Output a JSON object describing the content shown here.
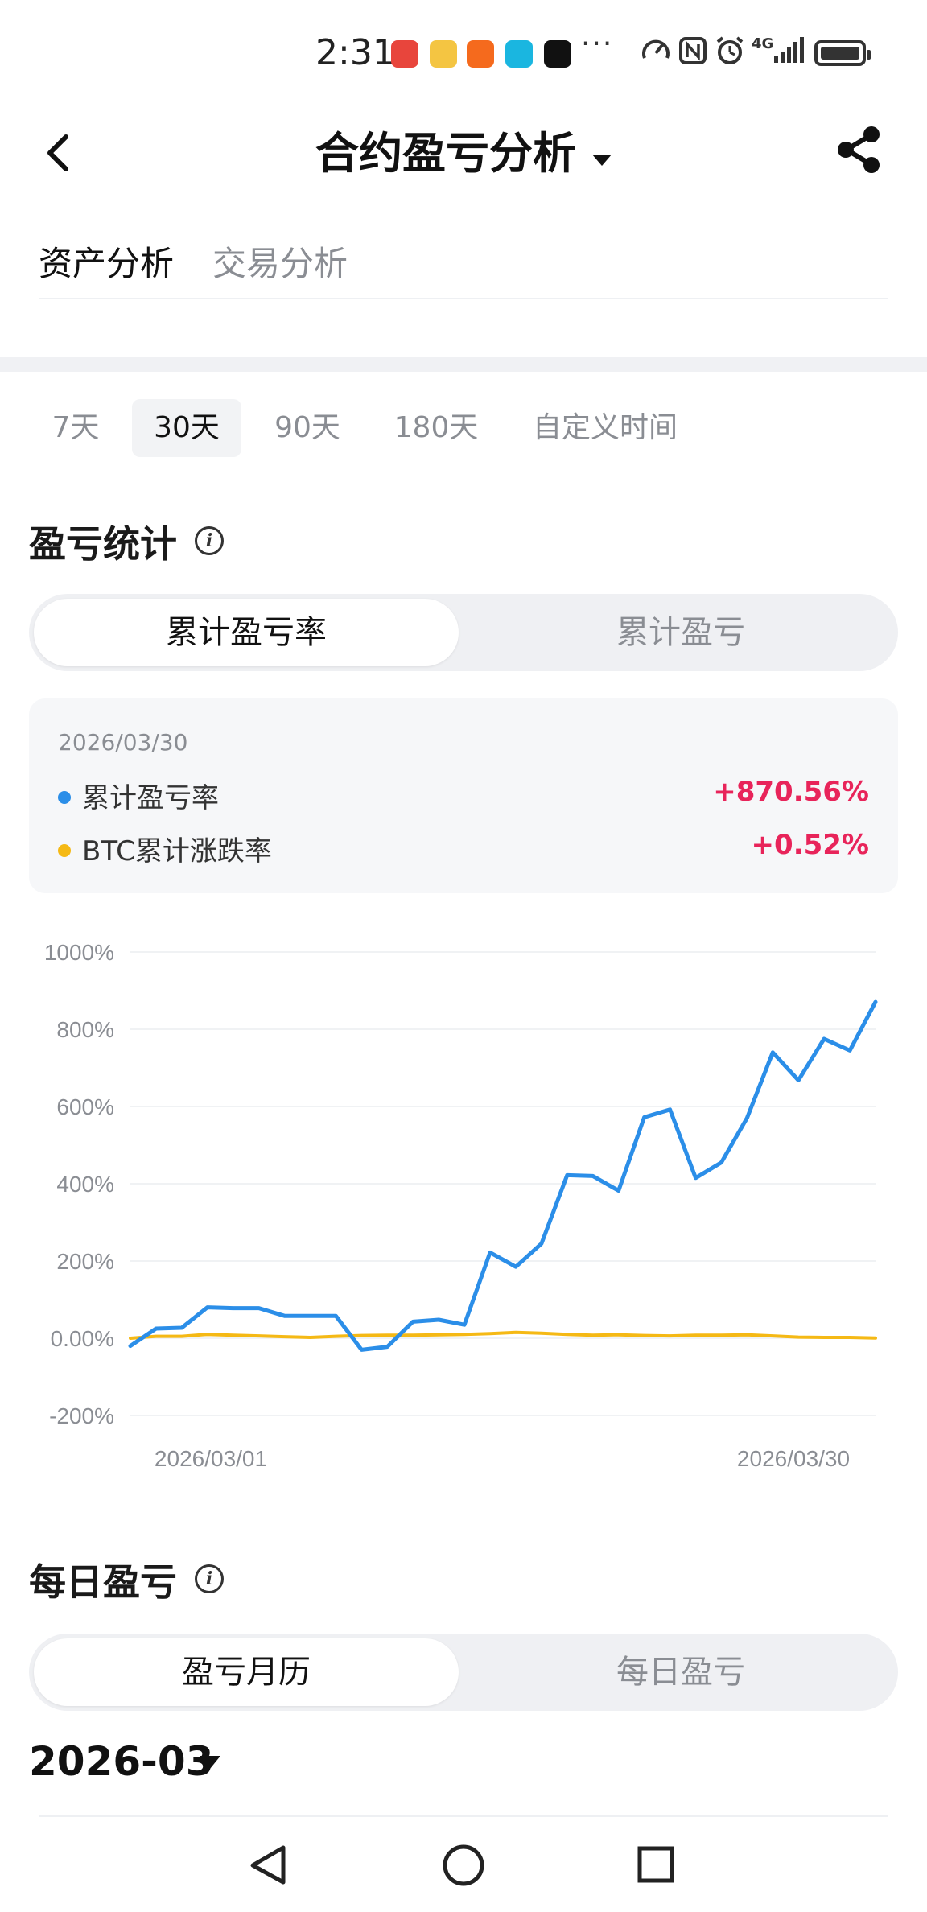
{
  "status_bar": {
    "time": "2:31",
    "network": "4G",
    "icons": [
      "app-icon-red",
      "weibo-icon",
      "taobao-icon",
      "app-icon-cyan",
      "app-icon-black",
      "more-dots-icon",
      "speed-icon",
      "nfc-icon",
      "alarm-icon",
      "signal-icon",
      "battery-icon"
    ],
    "more": "···"
  },
  "header": {
    "title": "合约盈亏分析",
    "back_icon": "chevron-left-icon",
    "dropdown_icon": "caret-down-icon",
    "share_icon": "share-icon"
  },
  "main_tabs": [
    {
      "label": "资产分析",
      "active": true
    },
    {
      "label": "交易分析",
      "active": false
    }
  ],
  "period_tabs": [
    {
      "label": "7天",
      "active": false
    },
    {
      "label": "30天",
      "active": true
    },
    {
      "label": "90天",
      "active": false
    },
    {
      "label": "180天",
      "active": false
    },
    {
      "label": "自定义时间",
      "active": false
    }
  ],
  "pnl_stats": {
    "title": "盈亏统计",
    "info_icon": "info-icon",
    "segments": [
      {
        "label": "累计盈亏率",
        "active": true
      },
      {
        "label": "累计盈亏",
        "active": false
      }
    ]
  },
  "tooltip": {
    "date": "2026/03/30",
    "rows": [
      {
        "label": "累计盈亏率",
        "value": "+870.56%",
        "color": "#2b8ee8"
      },
      {
        "label": "BTC累计涨跌率",
        "value": "+0.52%",
        "color": "#f5b915"
      }
    ]
  },
  "chart_data": {
    "type": "line",
    "y_ticks": [
      "1000%",
      "800%",
      "600%",
      "400%",
      "200%",
      "0.00%",
      "-200%"
    ],
    "x_tick_labels": [
      "2026/03/01",
      "2026/03/30"
    ],
    "ylim": [
      -200,
      1000
    ],
    "grid": true,
    "series": [
      {
        "name": "累计盈亏率",
        "color": "#2b8ee8",
        "values": [
          -20,
          25,
          27,
          80,
          78,
          78,
          58,
          58,
          58,
          -30,
          -22,
          43,
          48,
          35,
          222,
          185,
          245,
          422,
          420,
          382,
          572,
          592,
          415,
          455,
          570,
          740,
          668,
          775,
          745,
          870.56
        ]
      },
      {
        "name": "BTC累计涨跌率",
        "color": "#f5b915",
        "values": [
          0,
          5,
          5,
          10,
          8,
          6,
          4,
          2,
          5,
          7,
          8,
          8,
          9,
          10,
          12,
          15,
          13,
          10,
          8,
          9,
          7,
          6,
          8,
          8,
          9,
          6,
          3,
          2,
          2,
          0.52
        ]
      }
    ]
  },
  "daily_pnl": {
    "title": "每日盈亏",
    "info_icon": "info-icon",
    "segments": [
      {
        "label": "盈亏月历",
        "active": true
      },
      {
        "label": "每日盈亏",
        "active": false
      }
    ],
    "month": "2026-03",
    "month_icon": "caret-down-icon"
  },
  "nav_bar": {
    "icons": [
      "back-triangle-icon",
      "home-circle-icon",
      "recent-square-icon"
    ]
  }
}
